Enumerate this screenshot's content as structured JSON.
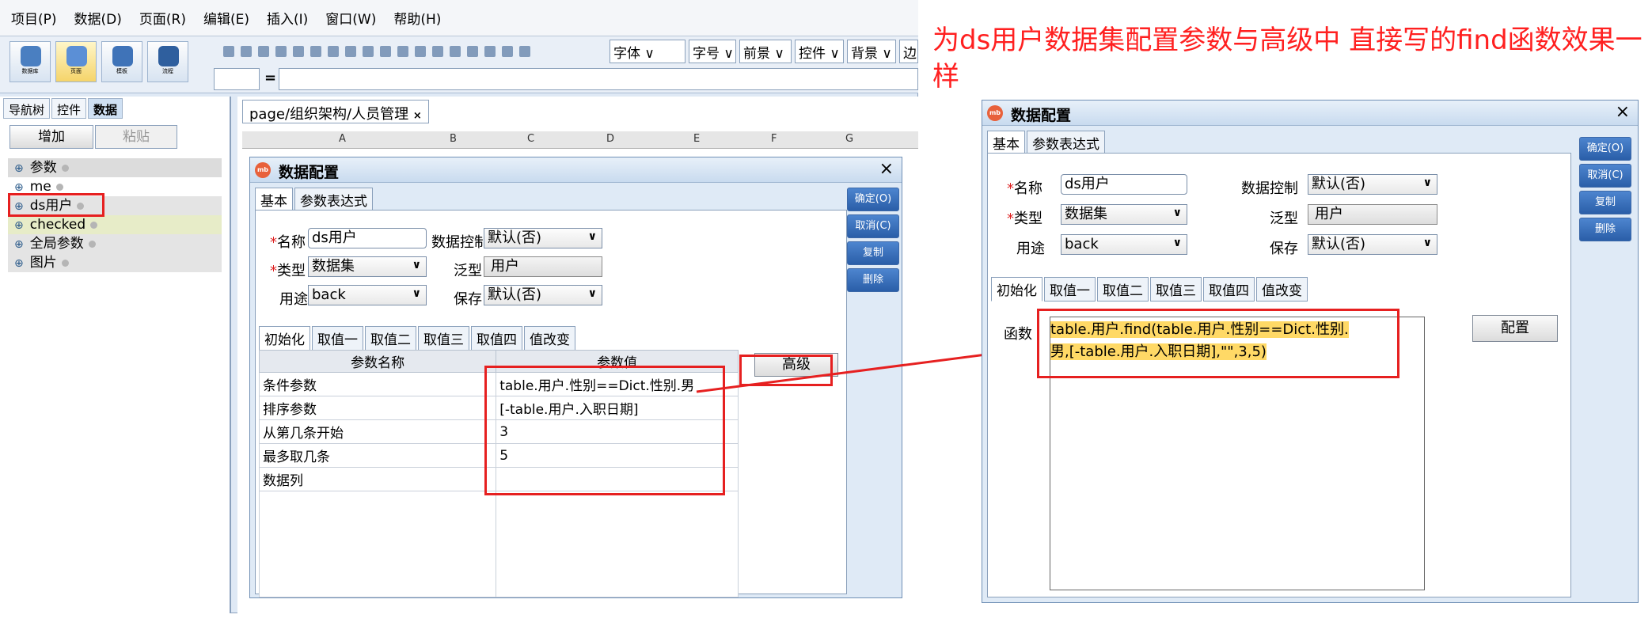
{
  "menu": [
    "项目(P)",
    "数据(D)",
    "页面(R)",
    "编辑(E)",
    "插入(I)",
    "窗口(W)",
    "帮助(H)"
  ],
  "toolbar": {
    "big_buttons": [
      "数据库",
      "页面",
      "模板",
      "流程"
    ],
    "combos": [
      "字体",
      "字号",
      "前景",
      "控件",
      "背景",
      "边"
    ],
    "formula_eq": "="
  },
  "left_panel": {
    "tabs": [
      "导航树",
      "控件",
      "数据"
    ],
    "add_label": "增加",
    "paste_label": "粘贴",
    "tree": [
      "参数",
      "me",
      "ds用户",
      "checked",
      "全局参数",
      "图片"
    ]
  },
  "main": {
    "page_tab": "page/组织架构/人员管理",
    "page_tab_close": "×",
    "columns": [
      "A",
      "B",
      "C",
      "D",
      "E",
      "F",
      "G"
    ]
  },
  "dialog1": {
    "title": "数据配置",
    "close": "×",
    "tabs": [
      "基本",
      "参数表达式"
    ],
    "name_label": "名称",
    "name_value": "ds用户",
    "type_label": "类型",
    "type_value": "数据集",
    "usage_label": "用途",
    "usage_value": "back",
    "data_control_label": "数据控制",
    "data_control_value": "默认(否)",
    "generic_label": "泛型",
    "generic_value": "用户",
    "save_label": "保存",
    "save_value": "默认(否)",
    "required_mark": "*",
    "side_buttons": [
      "确定(O)",
      "取消(C)",
      "复制",
      "删除"
    ],
    "subtabs": [
      "初始化",
      "取值一",
      "取值二",
      "取值三",
      "取值四",
      "值改变"
    ],
    "param_table": {
      "headers": [
        "参数名称",
        "参数值"
      ],
      "rows": [
        [
          "条件参数",
          "table.用户.性别==Dict.性别.男"
        ],
        [
          "排序参数",
          "[-table.用户.入职日期]"
        ],
        [
          "从第几条开始",
          "3"
        ],
        [
          "最多取几条",
          "5"
        ],
        [
          "数据列",
          ""
        ]
      ]
    },
    "advanced_label": "高级"
  },
  "annotation": "为ds用户数据集配置参数与高级中 直接写的find函数效果一样",
  "dialog2": {
    "title": "数据配置",
    "close": "×",
    "tabs": [
      "基本",
      "参数表达式"
    ],
    "name_label": "名称",
    "name_value": "ds用户",
    "type_label": "类型",
    "type_value": "数据集",
    "usage_label": "用途",
    "usage_value": "back",
    "data_control_label": "数据控制",
    "data_control_value": "默认(否)",
    "generic_label": "泛型",
    "generic_value": "用户",
    "save_label": "保存",
    "save_value": "默认(否)",
    "required_mark": "*",
    "side_buttons": [
      "确定(O)",
      "取消(C)",
      "复制",
      "删除"
    ],
    "subtabs": [
      "初始化",
      "取值一",
      "取值二",
      "取值三",
      "取值四",
      "值改变"
    ],
    "function_label": "函数",
    "function_line1": "table.用户.find(table.用户.性别==Dict.性别.",
    "function_line2": "男,[-table.用户.入职日期],\"\",3,5)",
    "config_label": "配置"
  },
  "colors": {
    "highlight_red": "#e62020",
    "side_button_blue": "#2a5ea8",
    "code_highlight": "#ffd966"
  }
}
